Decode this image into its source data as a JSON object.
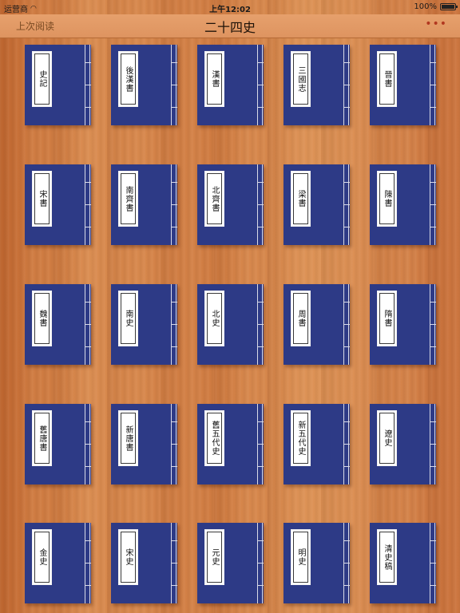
{
  "status_bar": {
    "carrier": "运营商",
    "time": "上午12:02",
    "battery": "100%"
  },
  "nav": {
    "back_label": "上次阅读",
    "title": "二十四史",
    "more_label": "•••"
  },
  "colors": {
    "book_cover": "#2d3a86",
    "nav_bg": "#e6a06c",
    "more_accent": "#b23820"
  },
  "books": [
    {
      "title": "史記"
    },
    {
      "title": "後漢書"
    },
    {
      "title": "漢書"
    },
    {
      "title": "三國志"
    },
    {
      "title": "晉書"
    },
    {
      "title": "宋書"
    },
    {
      "title": "南齊書"
    },
    {
      "title": "北齊書"
    },
    {
      "title": "梁書"
    },
    {
      "title": "陳書"
    },
    {
      "title": "魏書"
    },
    {
      "title": "南史"
    },
    {
      "title": "北史"
    },
    {
      "title": "周書"
    },
    {
      "title": "隋書"
    },
    {
      "title": "舊唐書"
    },
    {
      "title": "新唐書"
    },
    {
      "title": "舊五代史"
    },
    {
      "title": "新五代史"
    },
    {
      "title": "遼史"
    },
    {
      "title": "金史"
    },
    {
      "title": "宋史"
    },
    {
      "title": "元史"
    },
    {
      "title": "明史"
    },
    {
      "title": "清史稿"
    }
  ]
}
